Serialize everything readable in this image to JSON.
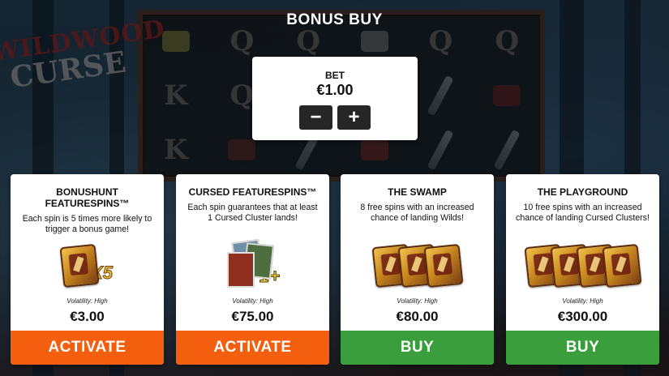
{
  "header": {
    "title": "BONUS BUY"
  },
  "logo": {
    "line1": "WILDWOOD",
    "line2": "CURSE"
  },
  "reel_symbols": [
    [
      "lantern",
      "Q",
      "Q",
      "cassette",
      "Q",
      "Q"
    ],
    [
      "K",
      "Q",
      "blob",
      "Q",
      "knife",
      "blob"
    ],
    [
      "K",
      "blob",
      "knife",
      "blob",
      "knife",
      "knife"
    ]
  ],
  "bet": {
    "label": "BET",
    "value": "€1.00",
    "minus_label": "−",
    "plus_label": "+"
  },
  "cards": [
    {
      "title": "BONUSHUNT FEATURESPINS™",
      "description": "Each spin is 5 times more likely to trigger a bonus game!",
      "volatility": "Volatility: High",
      "price": "€3.00",
      "action": "ACTIVATE",
      "action_color": "#f45e0f",
      "art_badge": "X5"
    },
    {
      "title": "CURSED FEATURESPINS™",
      "description": "Each spin guarantees that at least 1 Cursed Cluster lands!",
      "volatility": "Volatility: High",
      "price": "€75.00",
      "action": "ACTIVATE",
      "action_color": "#f45e0f",
      "art_badge": "1+"
    },
    {
      "title": "THE SWAMP",
      "description": "8 free spins with an increased chance of landing Wilds!",
      "volatility": "Volatility: High",
      "price": "€80.00",
      "action": "BUY",
      "action_color": "#3a9e3c",
      "art_badge": ""
    },
    {
      "title": "THE PLAYGROUND",
      "description": "10 free spins with an increased chance of landing Cursed Clusters!",
      "volatility": "Volatility: High",
      "price": "€300.00",
      "action": "BUY",
      "action_color": "#3a9e3c",
      "art_badge": ""
    }
  ]
}
